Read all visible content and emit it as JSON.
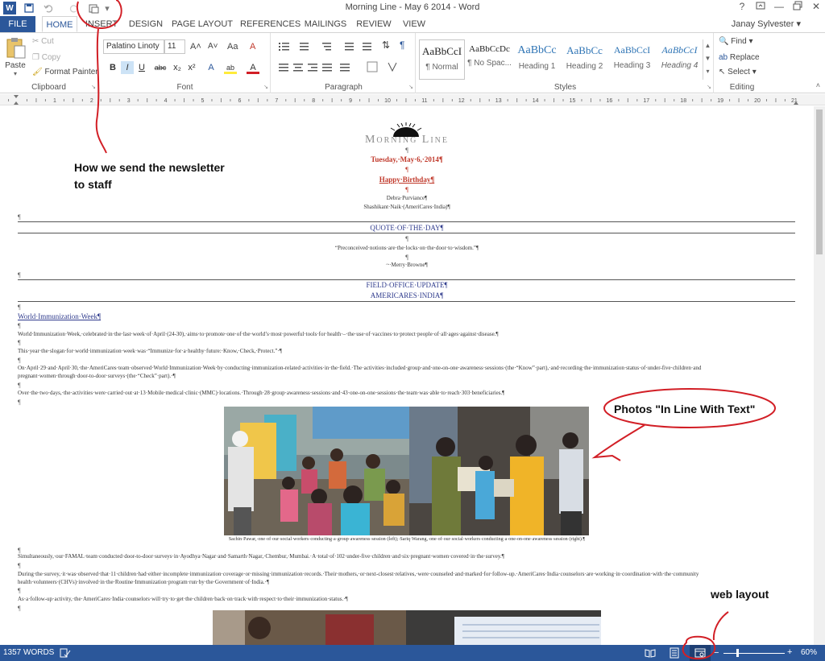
{
  "window": {
    "title": "Morning Line - May 6 2014 - Word",
    "controls": {
      "help": "?",
      "restore": "□",
      "minimize": "—",
      "maximize": "▭",
      "close": "✕"
    }
  },
  "quick_access": {
    "app_icon": "W",
    "save": "save-icon",
    "undo": "undo-icon",
    "redo": "redo-icon",
    "custom": "web-layout-icon",
    "more": "▾"
  },
  "tabs": [
    "FILE",
    "HOME",
    "INSERT",
    "DESIGN",
    "PAGE LAYOUT",
    "REFERENCES",
    "MAILINGS",
    "REVIEW",
    "VIEW"
  ],
  "active_tab": "HOME",
  "user": "Janay Sylvester",
  "ribbon": {
    "clipboard": {
      "paste": "Paste",
      "cut": "Cut",
      "copy": "Copy",
      "format_painter": "Format Painter",
      "label": "Clipboard"
    },
    "font": {
      "name": "Palatino Linoty",
      "size": "11",
      "label": "Font",
      "grow": "A˄",
      "shrink": "A˅",
      "case": "Aa",
      "clear": "A",
      "bold": "B",
      "italic": "I",
      "underline": "U",
      "strike": "abc",
      "sub": "x₂",
      "sup": "x²",
      "effects": "A",
      "highlight": "ab",
      "color": "A"
    },
    "paragraph": {
      "label": "Paragraph",
      "sort": "⇅",
      "pilcrow": "¶"
    },
    "styles": {
      "label": "Styles",
      "items": [
        {
          "sample": "AaBbCcI",
          "name": "¶ Normal"
        },
        {
          "sample": "AaBbCcDc",
          "name": "¶ No Spac..."
        },
        {
          "sample": "AaBbCc",
          "name": "Heading 1"
        },
        {
          "sample": "AaBbCc",
          "name": "Heading 2"
        },
        {
          "sample": "AaBbCcI",
          "name": "Heading 3"
        },
        {
          "sample": "AaBbCcI",
          "name": "Heading 4"
        }
      ]
    },
    "editing": {
      "find": "Find",
      "replace": "Replace",
      "select": "Select",
      "label": "Editing"
    }
  },
  "ruler": {
    "numbers": [
      "1",
      "2",
      "3",
      "4",
      "5",
      "6",
      "7",
      "8",
      "9",
      "10",
      "11",
      "12",
      "13",
      "14",
      "15",
      "16",
      "17",
      "18",
      "19",
      "20",
      "21"
    ]
  },
  "document": {
    "masthead": "Morning Line",
    "date": "Tuesday,·May·6,·2014¶",
    "birthday": "Happy·Birthday¶",
    "names": [
      "Debra·Purviance¶",
      "Shashikant·Naik·(AmeriCares·India)¶"
    ],
    "quote_head": "QUOTE·OF·THE·DAY¶",
    "quote": "“Preconceived·notions·are·the·locks·on·the·door·to·wisdom.”¶",
    "quote_author": "~·Merry·Browne¶",
    "section_head": [
      "FIELD·OFFICE·UPDATE¶",
      "AMERICARES·INDIA¶"
    ],
    "article_title": "World·Immunization·Week¶",
    "p1": "World·Immunization·Week,·celebrated·in·the·last·week·of·April·(24-30),·aims·to·promote·one·of·the·world’s·most·powerful·tools·for·health·–·the·use·of·vaccines·to·protect·people·of·all·ages·against·disease.¶",
    "p2": "This·year·the·slogan·for·world·immunization·week·was·“Immunize·for·a·healthy·future:·Know,·Check,·Protect.”·¶",
    "p3a": "On·April·29·and·April·30,·the·AmeriCares·team·observed·World·Immunization·Week·by·conducting·immunization-related·activities·in·the·field.·The·activities·included·group·and·one-on-one·awareness·sessions·(the·“Know”·part),·and·recording·the·immunization·status·of·under-five·children·and",
    "p3b": "pregnant·women·through·door-to-door·surveys·(the·“Check”·part).·¶",
    "p4": "Over·the·two·days,·the·activities·were·carried·out·at·13·Mobile·medical·clinic·(MMC)·locations.·Through·28·group·awareness·sessions·and·43·one-on-one·sessions·the·team·was·able·to·reach·303·beneficiaries.¶",
    "caption": "Sachin·Pawar,·one·of·our·social·workers·conducting·a·group·awareness·session·(left);·Sariq·Warang,·one·of·our·social·workers·conducting·a·one-on-one·awareness·session·(right).¶",
    "p5": "Simultaneously,·our·FAMAL·team·conducted·door-to-door·surveys·in·Ayodhya·Nagar·and·Samarth·Nagar,·Chembur,·Mumbai.·A·total·of·102·under-five·children·and·six·pregnant·women·covered·in·the·survey.¶",
    "p6a": "During·the·survey,·it·was·observed·that·11·children·had·either·incomplete·immunization·coverage·or·missing·immunization·records.·Their·mothers,·or·next-closest·relatives,·were·counseled·and·marked·for·follow-up.·AmeriCares·India·counselors·are·working·in·coordination·with·the·community",
    "p6b": "health·volunteers·(CHVs)·involved·in·the·Routine·Immunization·program·run·by·the·Government·of·India.·¶",
    "p7": "As·a·follow-up·activity,·the·AmeriCares·India·counselors·will·try·to·get·the·children·back·on·track·with·respect·to·their·immunization·status.·¶",
    "pilcrow": "¶"
  },
  "annotations": {
    "newsletter": [
      "How we send the newsletter",
      "to staff"
    ],
    "photos": "Photos \"In Line With Text\"",
    "web_layout": "web layout"
  },
  "status": {
    "words": "1357 WORDS",
    "zoom": "60%",
    "zoom_level": 0.6
  },
  "colors": {
    "accent": "#2b579a",
    "red_text": "#c0392b",
    "blue_text": "#2e3a8c",
    "annotation": "#d21f26"
  }
}
